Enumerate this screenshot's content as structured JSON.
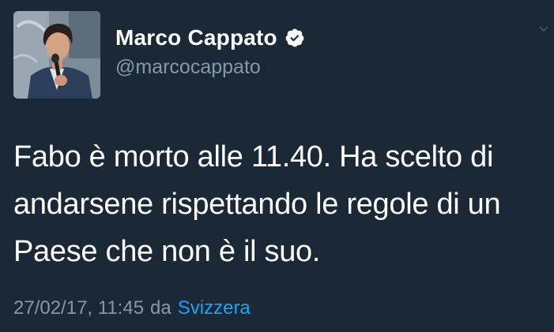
{
  "tweet": {
    "author": {
      "display_name": "Marco Cappato",
      "handle": "@marcocappato",
      "verified": true
    },
    "text": "Fabo è morto alle 11.40. Ha scelto di\nandarsene rispettando le regole di un\nPaese che non è il suo.",
    "timestamp": "27/02/17, 11:45",
    "via_label": "da",
    "source": "Svizzera"
  },
  "colors": {
    "background": "#1b2836",
    "text_primary": "#ffffff",
    "text_secondary": "#8899a6",
    "link": "#1da1f2"
  },
  "icons": {
    "verified": "verified-badge-icon",
    "menu": "chevron-down-icon"
  }
}
